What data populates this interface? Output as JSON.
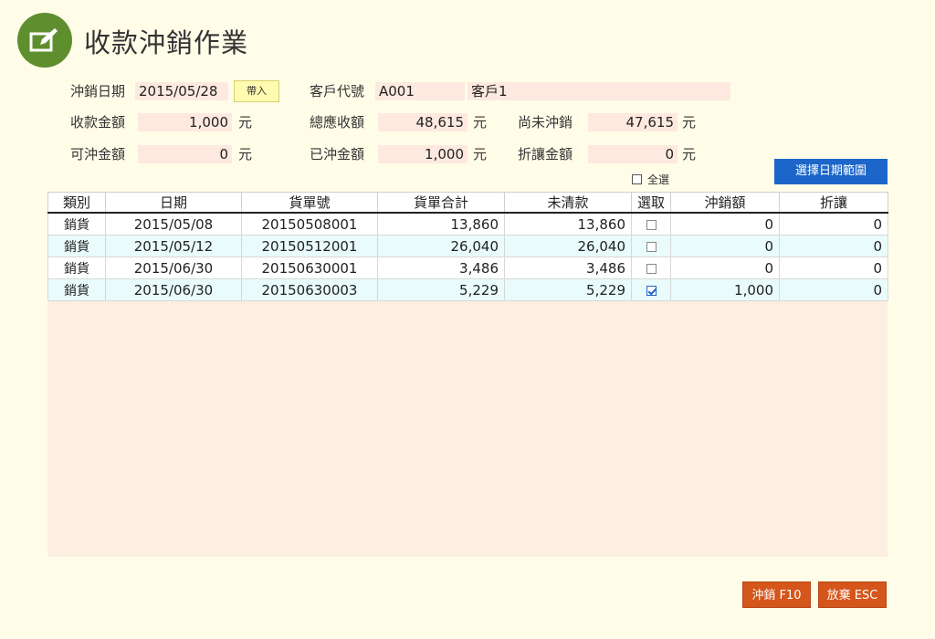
{
  "header": {
    "title": "收款沖銷作業",
    "icon": "edit-icon"
  },
  "form": {
    "date_label": "沖銷日期",
    "date_value": "2015/05/28",
    "import_label": "帶入",
    "customer_code_label": "客戶代號",
    "customer_code_value": "A001",
    "customer_name_value": "客戶1",
    "received_label": "收款金額",
    "received_value": "1,000",
    "receivable_label": "總應收額",
    "receivable_value": "48,615",
    "unwritten_label": "尚未沖銷",
    "unwritten_value": "47,615",
    "available_label": "可沖金額",
    "available_value": "0",
    "written_label": "已沖金額",
    "written_value": "1,000",
    "discount_label": "折讓金額",
    "discount_value": "0",
    "unit": "元"
  },
  "select_all_label": "全選",
  "date_range_button": "選擇日期範圍",
  "table": {
    "columns": [
      "類別",
      "日期",
      "貨單號",
      "貨單合計",
      "未清款",
      "選取",
      "沖銷額",
      "折讓"
    ],
    "rows": [
      {
        "category": "銷貨",
        "date": "2015/05/08",
        "order_no": "20150508001",
        "total": "13,860",
        "outstanding": "13,860",
        "selected": false,
        "writeoff": "0",
        "discount": "0"
      },
      {
        "category": "銷貨",
        "date": "2015/05/12",
        "order_no": "20150512001",
        "total": "26,040",
        "outstanding": "26,040",
        "selected": false,
        "writeoff": "0",
        "discount": "0"
      },
      {
        "category": "銷貨",
        "date": "2015/06/30",
        "order_no": "20150630001",
        "total": "3,486",
        "outstanding": "3,486",
        "selected": false,
        "writeoff": "0",
        "discount": "0"
      },
      {
        "category": "銷貨",
        "date": "2015/06/30",
        "order_no": "20150630003",
        "total": "5,229",
        "outstanding": "5,229",
        "selected": true,
        "writeoff": "1,000",
        "discount": "0"
      }
    ]
  },
  "actions": {
    "confirm": "沖銷 F10",
    "cancel": "放棄 ESC"
  },
  "colors": {
    "accent_green": "#5f8e2e",
    "primary_blue": "#1d66c9",
    "action_orange": "#d4561b",
    "field_bg": "#fde9df"
  }
}
